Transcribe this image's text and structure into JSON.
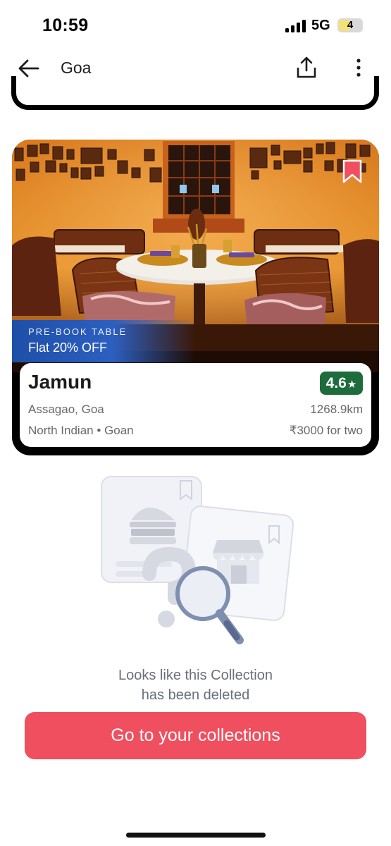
{
  "status_bar": {
    "time": "10:59",
    "network": "5G",
    "battery": "4"
  },
  "header": {
    "title": "Goa",
    "back_icon": "arrow-left-icon",
    "share_icon": "share-icon",
    "more_icon": "more-vertical-icon"
  },
  "restaurant": {
    "name": "Jamun",
    "rating": "4.6",
    "rating_color": "#1e6b3c",
    "location": "Assagao, Goa",
    "distance": "1268.9km",
    "cuisine": "North Indian • Goan",
    "price": "₹3000 for two",
    "offer_label": "PRE-BOOK TABLE",
    "offer_text": "Flat 20% OFF",
    "bookmark_icon": "bookmark-icon",
    "bookmark_color": "#ef4f5f"
  },
  "empty_state": {
    "line1": "Looks like this Collection",
    "line2": "has been deleted",
    "illustration": "magnifying-glass-question-icon"
  },
  "cta": {
    "label": "Go to your collections",
    "color": "#ef4f5f"
  }
}
